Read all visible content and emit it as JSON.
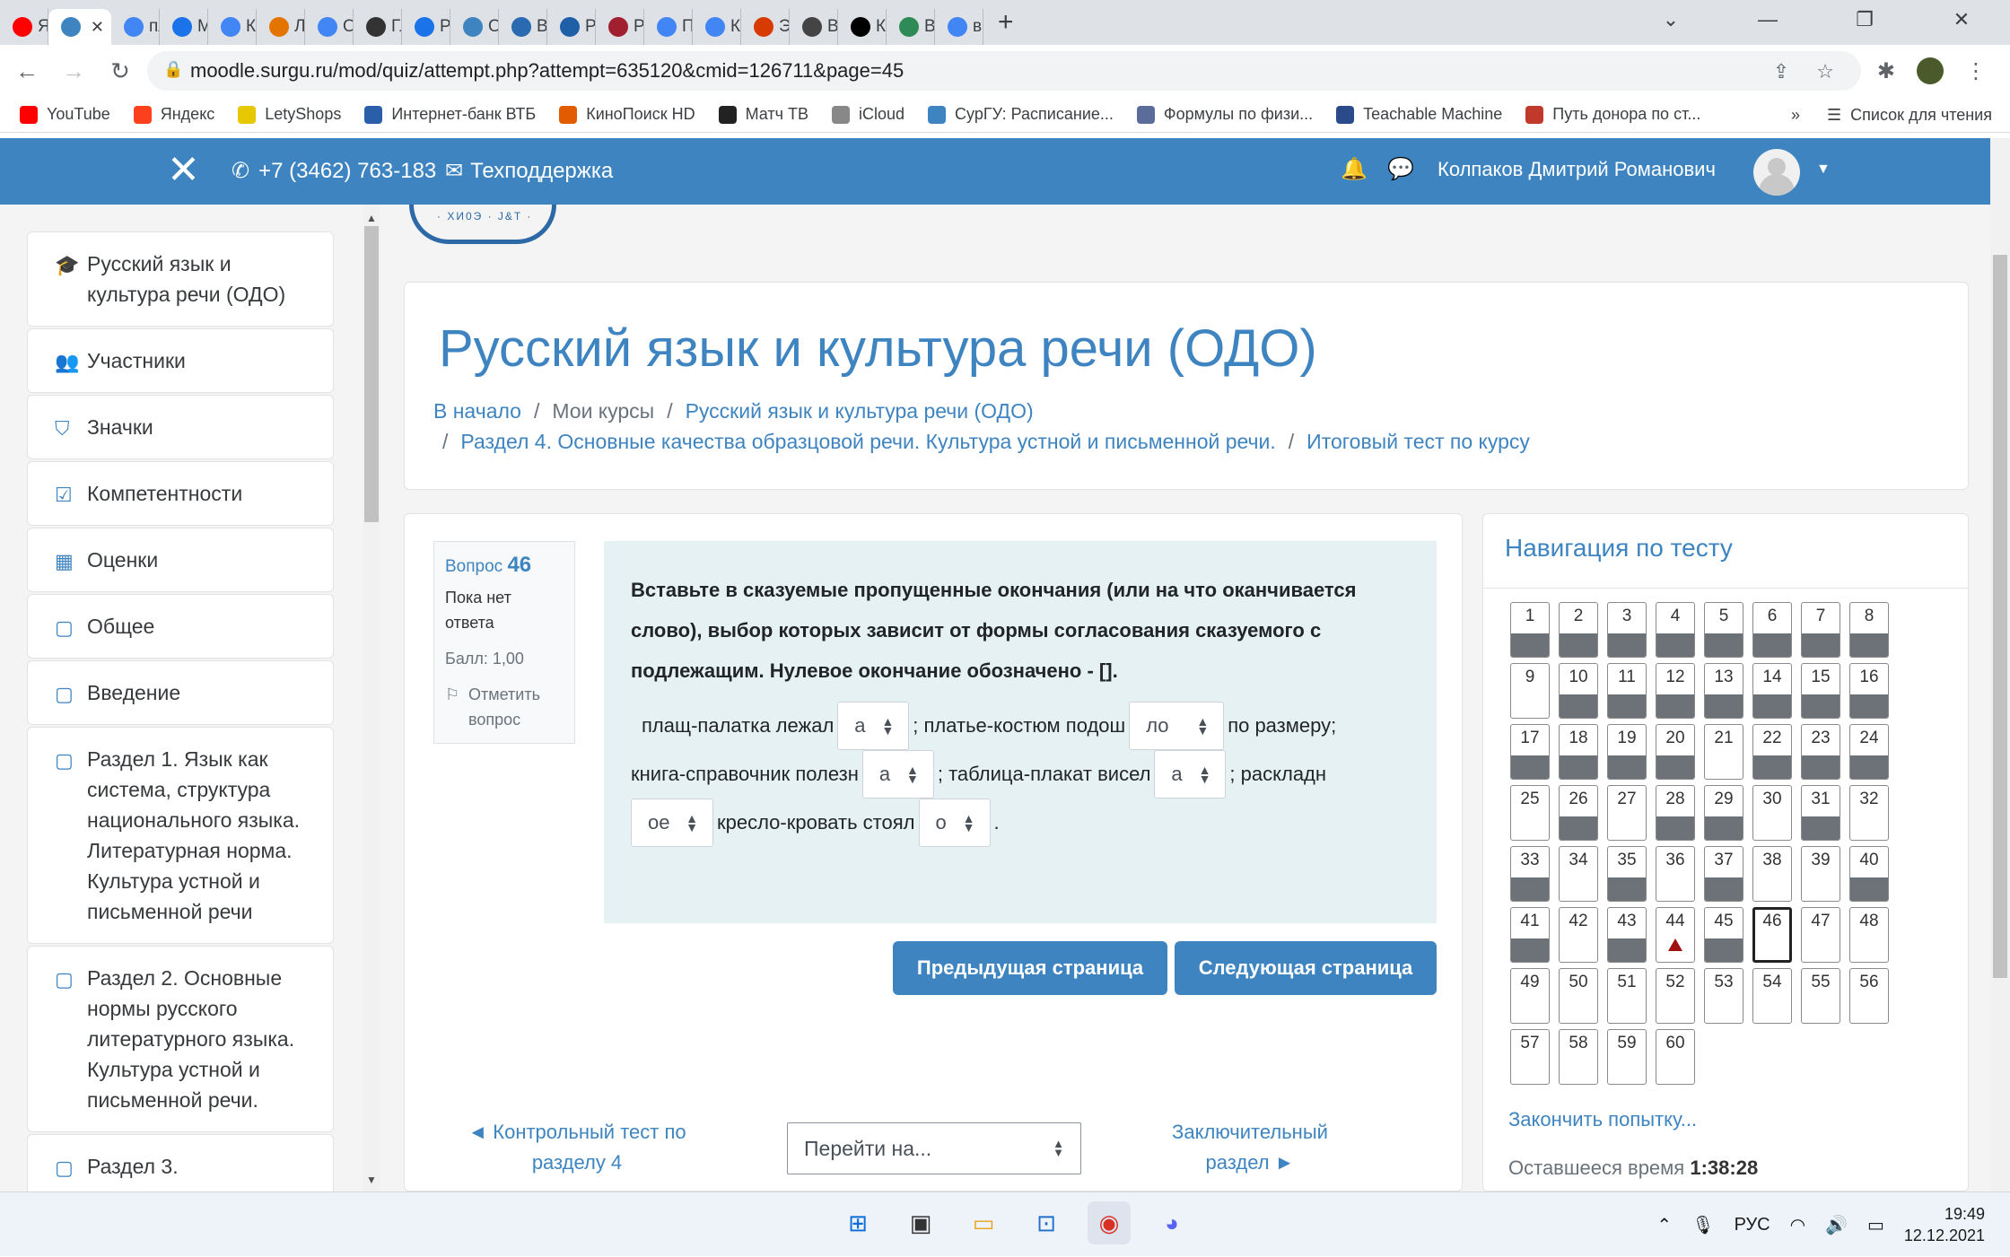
{
  "browser": {
    "tabs": [
      {
        "label": "Я -",
        "color": "#ff0000"
      },
      {
        "label": "",
        "color": "#3e84c0",
        "active": true
      },
      {
        "label": "пла",
        "color": "#4285f4"
      },
      {
        "label": "Мес",
        "color": "#1a73e8"
      },
      {
        "label": "К не",
        "color": "#4285f4"
      },
      {
        "label": "Лек",
        "color": "#e37400"
      },
      {
        "label": "Опр",
        "color": "#4285f4"
      },
      {
        "label": "Глав",
        "color": "#333333"
      },
      {
        "label": "Реш",
        "color": "#1a73e8"
      },
      {
        "label": "Отв",
        "color": "#3e84c0"
      },
      {
        "label": "Вне",
        "color": "#2a6ab1"
      },
      {
        "label": "Реч",
        "color": "#1e5fa8"
      },
      {
        "label": "Рус",
        "color": "#a02030"
      },
      {
        "label": "Пол",
        "color": "#4285f4"
      },
      {
        "label": "Как",
        "color": "#4285f4"
      },
      {
        "label": "ЭОР",
        "color": "#d83b01"
      },
      {
        "label": "Вер",
        "color": "#444444"
      },
      {
        "label": "Как",
        "color": "#000000"
      },
      {
        "label": "Вер",
        "color": "#2e8b57"
      },
      {
        "label": "вве",
        "color": "#4285f4"
      }
    ],
    "url": "moodle.surgu.ru/mod/quiz/attempt.php?attempt=635120&cmid=126711&page=45",
    "bookmarks": [
      "YouTube",
      "Яндекс",
      "LetyShops",
      "Интернет-банк ВТБ",
      "КиноПоиск HD",
      "Матч ТВ",
      "iCloud",
      "СурГУ: Расписание...",
      "Формулы по физи...",
      "Teachable Machine",
      "Путь донора по ст..."
    ],
    "bookmarks_more": "»",
    "reading_list": "Список для чтения"
  },
  "topbar": {
    "phone": "+7 (3462) 763-183",
    "support": "Техподдержка",
    "user_name": "Колпаков Дмитрий Романович"
  },
  "sidebar": {
    "items": [
      {
        "label": "Русский язык и культура речи (ОДО)",
        "icon": "graduation-cap-icon"
      },
      {
        "label": "Участники",
        "icon": "users-icon"
      },
      {
        "label": "Значки",
        "icon": "shield-icon"
      },
      {
        "label": "Компетентности",
        "icon": "checkbox-icon"
      },
      {
        "label": "Оценки",
        "icon": "table-icon"
      },
      {
        "label": "Общее",
        "icon": "folder-icon"
      },
      {
        "label": "Введение",
        "icon": "folder-icon"
      },
      {
        "label": "Раздел 1. Язык как система, структура национального языка. Литературная норма. Культура устной и письменной речи",
        "icon": "folder-icon"
      },
      {
        "label": "Раздел 2. Основные нормы русского литературного языка. Культура устной и письменной речи.",
        "icon": "folder-icon"
      },
      {
        "label": "Раздел 3.",
        "icon": "folder-icon"
      }
    ]
  },
  "course": {
    "title": "Русский язык и культура речи (ОДО)",
    "breadcrumb": {
      "home": "В начало",
      "my_courses": "Мои курсы",
      "course": "Русский язык и культура речи (ОДО)",
      "section": "Раздел 4. Основные качества образцовой речи. Культура устной и письменной речи.",
      "quiz": "Итоговый тест по курсу"
    }
  },
  "question": {
    "label": "Вопрос",
    "number": "46",
    "status": "Пока нет ответа",
    "score": "Балл: 1,00",
    "flag": "Отметить вопрос",
    "text": "Вставьте в сказуемые пропущенные окончания (или на что оканчивается слово), выбор которых зависит от формы согласования сказуемого с подлежащим. Нулевое окончание обозначено - [].",
    "p1": "плащ-палатка лежал",
    "s1": "а",
    "p2": "; платье-костюм подош",
    "s2": "ло",
    "p3": "по размеру;",
    "p4": "книга-справочник полезн",
    "s3": "а",
    "p5": "; таблица-плакат висел",
    "s4": "а",
    "p6": "; раскладн",
    "s5": "ое",
    "p7": "кресло-кровать стоял",
    "s6": "о",
    "p8": "."
  },
  "buttons": {
    "prev_page": "Предыдущая страница",
    "next_page": "Следующая страница"
  },
  "footer_nav": {
    "prev_link": "◄ Контрольный тест по разделу 4",
    "jump_placeholder": "Перейти на...",
    "next_link": "Заключительный раздел ►"
  },
  "quiz_nav": {
    "title": "Навигация по тесту",
    "answered": [
      1,
      2,
      3,
      4,
      5,
      6,
      7,
      8,
      10,
      11,
      12,
      13,
      14,
      15,
      16,
      17,
      18,
      19,
      20,
      22,
      23,
      24,
      26,
      28,
      29,
      31,
      33,
      35,
      37,
      40,
      41,
      43,
      45
    ],
    "current": 46,
    "flagged": 44,
    "total": 60,
    "finish": "Закончить попытку...",
    "timer_label": "Оставшееся время",
    "timer_value": "1:38:28"
  },
  "taskbar": {
    "lang": "РУС",
    "time": "19:49",
    "date": "12.12.2021"
  }
}
